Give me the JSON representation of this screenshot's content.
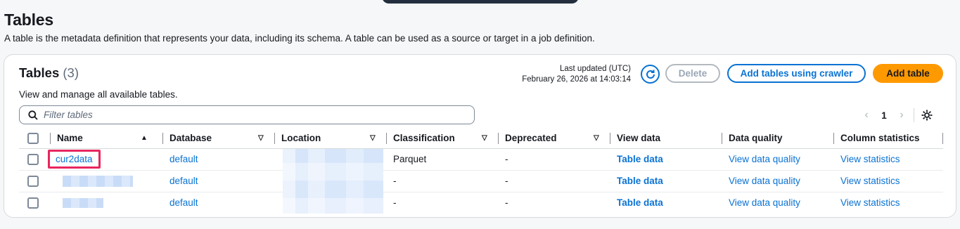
{
  "page": {
    "title": "Tables",
    "description": "A table is the metadata definition that represents your data, including its schema. A table can be used as a source or target in a job definition."
  },
  "container": {
    "title": "Tables",
    "count": "(3)",
    "subtitle": "View and manage all available tables.",
    "last_updated_label": "Last updated (UTC)",
    "last_updated_value": "February 26, 2026 at 14:03:14",
    "buttons": {
      "delete": "Delete",
      "add_crawler": "Add tables using crawler",
      "add_table": "Add table"
    },
    "filter_placeholder": "Filter tables",
    "pager": {
      "page": "1"
    }
  },
  "table": {
    "columns": [
      "Name",
      "Database",
      "Location",
      "Classification",
      "Deprecated",
      "View data",
      "Data quality",
      "Column statistics"
    ],
    "rows": [
      {
        "name": "cur2data",
        "database": "default",
        "classification": "Parquet",
        "deprecated": "-",
        "view_data": "Table data",
        "data_quality": "View data quality",
        "column_statistics": "View statistics"
      },
      {
        "name": "",
        "database": "default",
        "classification": "-",
        "deprecated": "-",
        "view_data": "Table data",
        "data_quality": "View data quality",
        "column_statistics": "View statistics"
      },
      {
        "name": "",
        "database": "default",
        "classification": "-",
        "deprecated": "-",
        "view_data": "Table data",
        "data_quality": "View data quality",
        "column_statistics": "View statistics"
      }
    ]
  },
  "colors": {
    "link": "#0972d3",
    "primary_button": "#ff9900",
    "highlight": "#e8265e"
  },
  "icons": [
    "refresh-icon",
    "search-icon",
    "chevron-left-icon",
    "chevron-right-icon",
    "gear-icon",
    "sort-desc-icon",
    "sort-caret-icon"
  ]
}
